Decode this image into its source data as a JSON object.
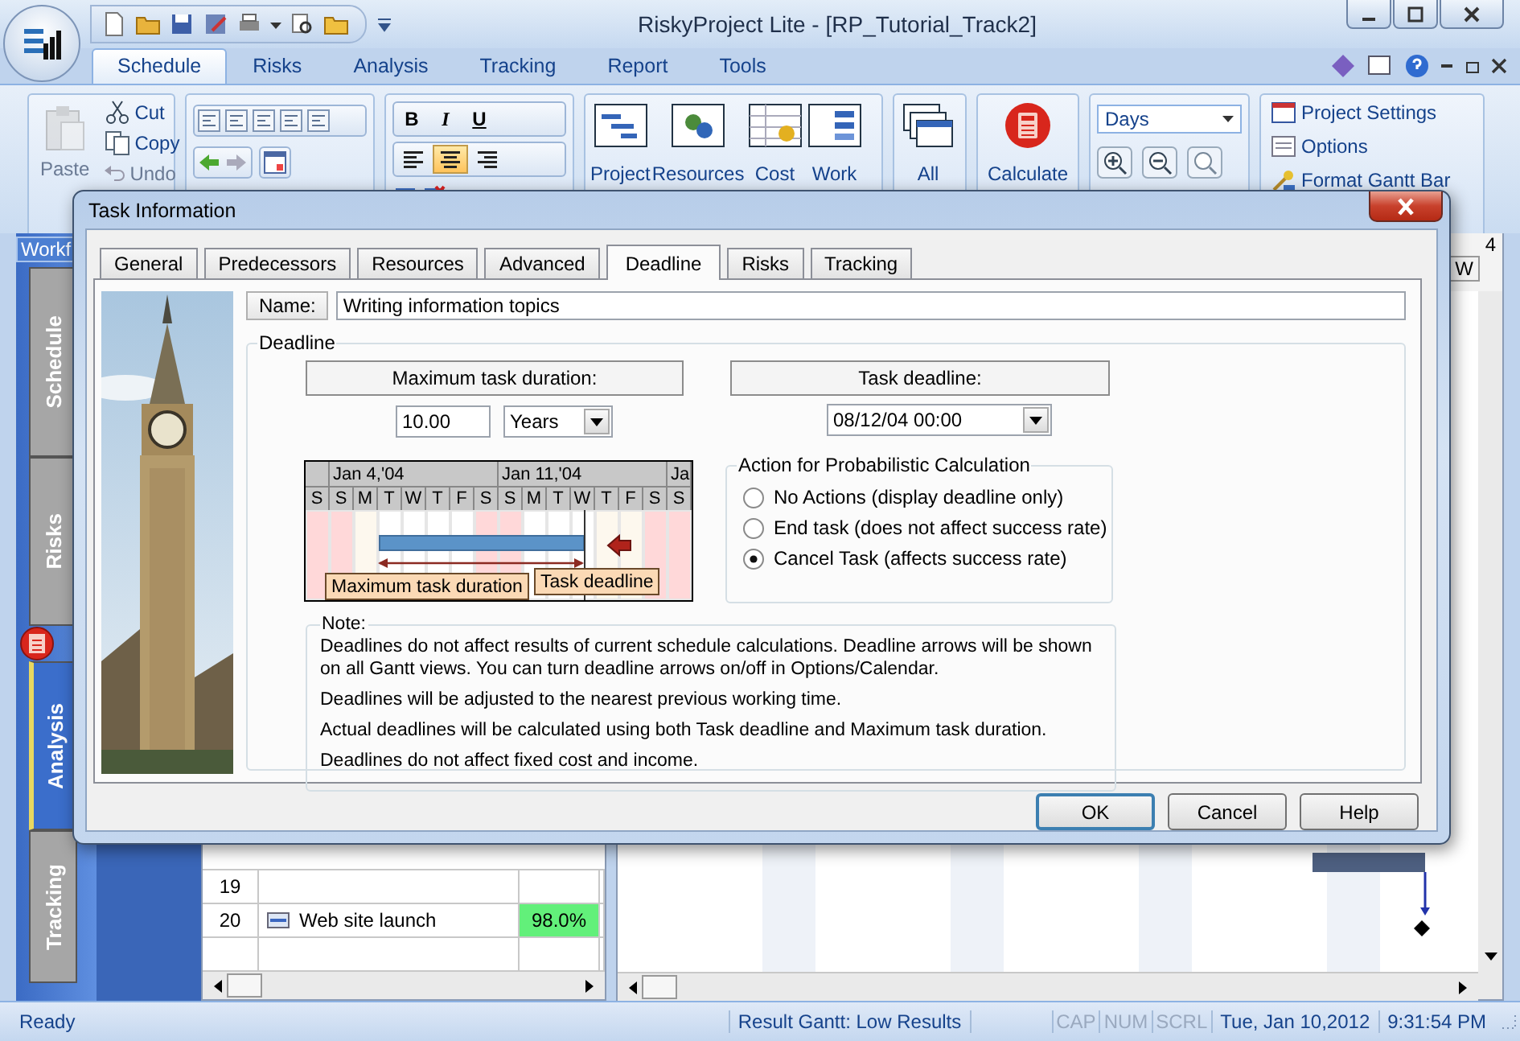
{
  "window": {
    "title": "RiskyProject Lite - [RP_Tutorial_Track2]"
  },
  "ribbon_tabs": [
    {
      "label": "Schedule",
      "selected": true
    },
    {
      "label": "Risks",
      "selected": false
    },
    {
      "label": "Analysis",
      "selected": false
    },
    {
      "label": "Tracking",
      "selected": false
    },
    {
      "label": "Report",
      "selected": false
    },
    {
      "label": "Tools",
      "selected": false
    }
  ],
  "clipboard": [
    {
      "label": "Paste",
      "kind": "large",
      "disabled": true
    },
    {
      "label": "Cut",
      "kind": "small",
      "disabled": false
    },
    {
      "label": "Copy",
      "kind": "small",
      "disabled": false
    },
    {
      "label": "Undo",
      "kind": "small",
      "disabled": true
    }
  ],
  "format_buttons": [
    {
      "label": "B",
      "selected": false
    },
    {
      "label": "I",
      "selected": false
    },
    {
      "label": "U",
      "selected": false
    }
  ],
  "alignment_buttons": [
    {
      "selected": false
    },
    {
      "selected": true
    },
    {
      "selected": false
    }
  ],
  "view_buttons": [
    "Project",
    "Resources",
    "Cost",
    "Work"
  ],
  "all_views": "All",
  "calculate": "Calculate",
  "zoom_unit": "Days",
  "project_links": [
    "Project Settings",
    "Options",
    "Format Gantt Bar"
  ],
  "workflow_label": "Workf",
  "side_tabs": [
    {
      "label": "Schedule",
      "selected": false
    },
    {
      "label": "Risks",
      "selected": false
    },
    {
      "label": "Analysis",
      "selected": true
    },
    {
      "label": "Tracking",
      "selected": false
    }
  ],
  "table_rows": [
    {
      "number": "19",
      "name": "",
      "value": ""
    },
    {
      "number": "20",
      "name": "Web site launch",
      "value": "98.0%"
    }
  ],
  "gantt_header": {
    "period": "4",
    "day": "W"
  },
  "dialog": {
    "title": "Task Information",
    "tabs": [
      {
        "label": "General",
        "selected": false
      },
      {
        "label": "Predecessors",
        "selected": false
      },
      {
        "label": "Resources",
        "selected": false
      },
      {
        "label": "Advanced",
        "selected": false
      },
      {
        "label": "Deadline",
        "selected": true
      },
      {
        "label": "Risks",
        "selected": false
      },
      {
        "label": "Tracking",
        "selected": false
      }
    ],
    "name_label": "Name:",
    "name_value": "Writing information topics",
    "group_title": "Deadline",
    "max_duration": {
      "header": "Maximum task duration:",
      "value": "10.00",
      "unit": "Years"
    },
    "deadline": {
      "header": "Task deadline:",
      "value": "08/12/04 00:00"
    },
    "diagram": {
      "leading_days": [
        {
          "label": "S",
          "weekend": true,
          "in_task": false
        }
      ],
      "weeks": [
        {
          "label": "Jan 4,'04",
          "days": [
            {
              "label": "S",
              "weekend": true,
              "in_task": false
            },
            {
              "label": "M",
              "weekend": false,
              "in_task": false
            },
            {
              "label": "T",
              "weekend": false,
              "in_task": true
            },
            {
              "label": "W",
              "weekend": false,
              "in_task": true
            },
            {
              "label": "T",
              "weekend": false,
              "in_task": true
            },
            {
              "label": "F",
              "weekend": false,
              "in_task": true
            },
            {
              "label": "S",
              "weekend": true,
              "in_task": true
            }
          ]
        },
        {
          "label": "Jan 11,'04",
          "days": [
            {
              "label": "S",
              "weekend": true,
              "in_task": true
            },
            {
              "label": "M",
              "weekend": false,
              "in_task": true
            },
            {
              "label": "T",
              "weekend": false,
              "in_task": true
            },
            {
              "label": "W",
              "weekend": false,
              "in_task": true
            },
            {
              "label": "T",
              "weekend": false,
              "in_task": false
            },
            {
              "label": "F",
              "weekend": false,
              "in_task": false
            },
            {
              "label": "S",
              "weekend": true,
              "in_task": false
            }
          ]
        },
        {
          "label": "Ja",
          "days": [
            {
              "label": "S",
              "weekend": true,
              "in_task": false
            }
          ]
        }
      ],
      "duration_label": "Maximum task duration",
      "deadline_label": "Task deadline"
    },
    "action": {
      "title": "Action for Probabilistic Calculation",
      "options": [
        {
          "label": "No Actions (display deadline only)",
          "selected": false
        },
        {
          "label": "End task (does not affect success rate)",
          "selected": false
        },
        {
          "label": "Cancel Task (affects success rate)",
          "selected": true
        }
      ]
    },
    "note": {
      "title": "Note:",
      "lines": [
        "Deadlines do not affect results of current schedule calculations. Deadline arrows will be shown on all Gantt views. You can turn deadline arrows on/off in Options/Calendar.",
        "Deadlines will be adjusted to the nearest previous working time.",
        "Actual deadlines will be calculated using both Task deadline and Maximum task duration.",
        "Deadlines do not affect fixed cost and income."
      ]
    },
    "buttons": [
      {
        "label": "OK",
        "default": true
      },
      {
        "label": "Cancel",
        "default": false
      },
      {
        "label": "Help",
        "default": false
      }
    ]
  },
  "status_bar": {
    "message": "Ready",
    "result": "Result Gantt: Low Results",
    "indicators": [
      {
        "label": "CAP",
        "on": false
      },
      {
        "label": "NUM",
        "on": false
      },
      {
        "label": "SCRL",
        "on": false
      }
    ],
    "date": "Tue, Jan 10,2012",
    "time": "9:31:54 PM"
  }
}
